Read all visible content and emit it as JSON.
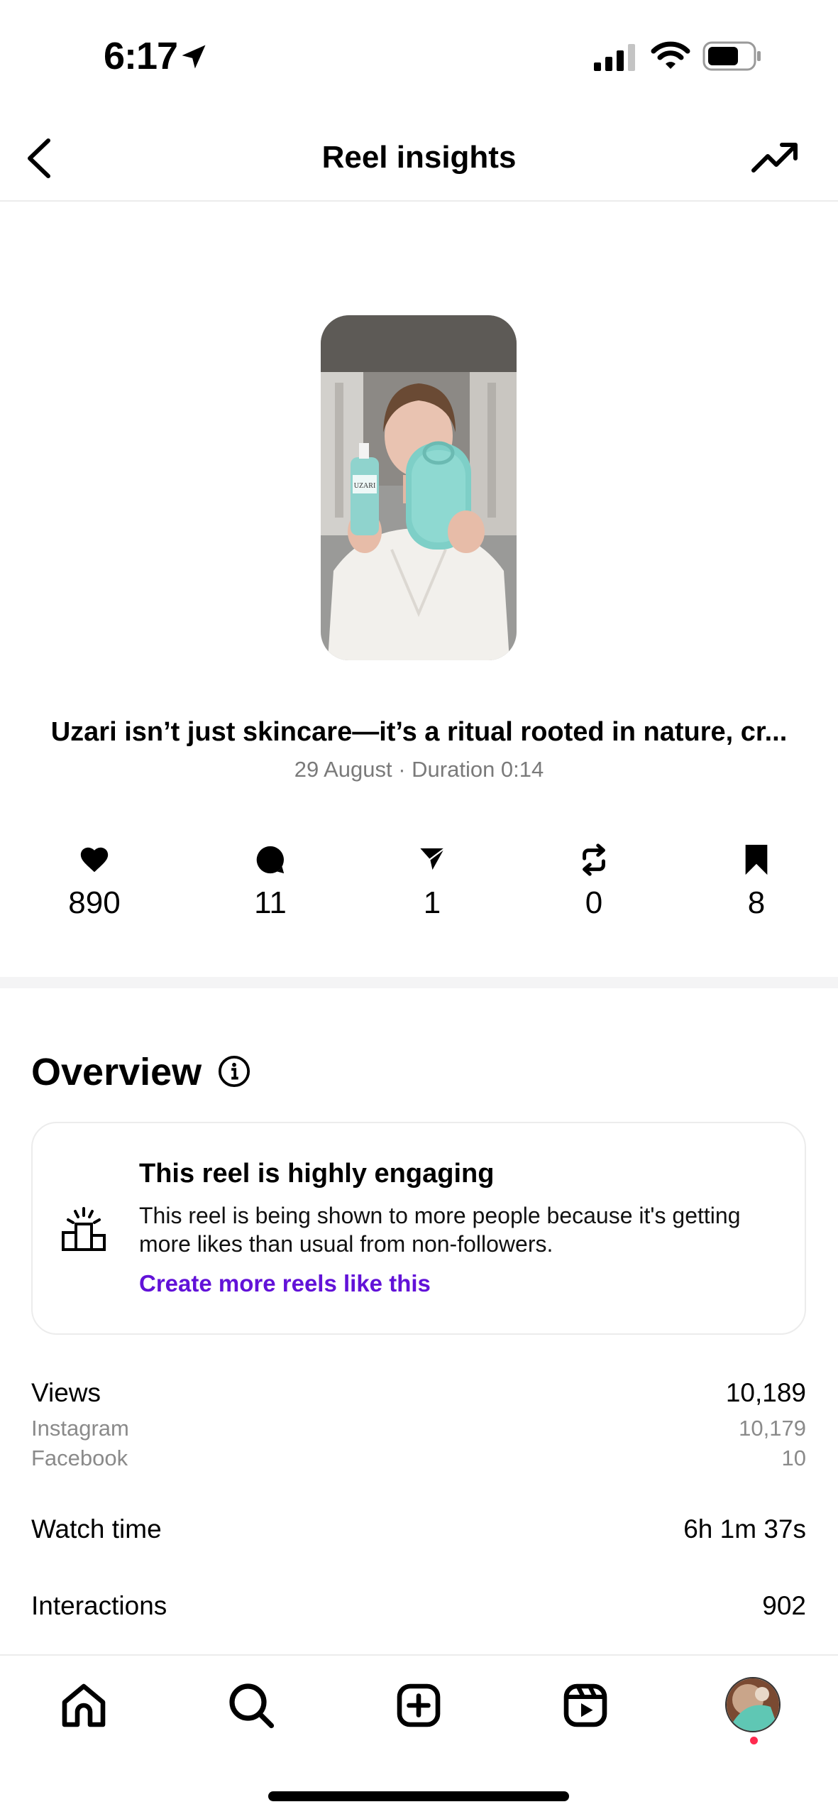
{
  "status_bar": {
    "time": "6:17"
  },
  "header": {
    "title": "Reel insights"
  },
  "reel": {
    "caption": "Uzari isn’t just skincare—it’s a ritual rooted in nature, cr...",
    "meta": "29 August · Duration 0:14",
    "bottle_label": "UZARI"
  },
  "stats": [
    {
      "icon": "heart-icon",
      "value": "890"
    },
    {
      "icon": "comment-icon",
      "value": "11"
    },
    {
      "icon": "share-icon",
      "value": "1"
    },
    {
      "icon": "repost-icon",
      "value": "0"
    },
    {
      "icon": "bookmark-icon",
      "value": "8"
    }
  ],
  "overview": {
    "title": "Overview",
    "card": {
      "title": "This reel is highly engaging",
      "body": "This reel is being shown to more people because it's getting more likes than usual from non-followers.",
      "link": "Create more reels like this",
      "link_color": "#6212d8"
    },
    "views": {
      "label": "Views",
      "value": "10,189"
    },
    "instagram": {
      "label": "Instagram",
      "value": "10,179"
    },
    "facebook": {
      "label": "Facebook",
      "value": "10"
    },
    "watch_time": {
      "label": "Watch time",
      "value": "6h 1m 37s"
    },
    "interactions": {
      "label": "Interactions",
      "value": "902"
    }
  },
  "tab_bar": {
    "tabs": [
      "home-icon",
      "search-icon",
      "create-icon",
      "reels-icon",
      "profile-avatar"
    ],
    "notification_color": "#ff2a4f"
  }
}
